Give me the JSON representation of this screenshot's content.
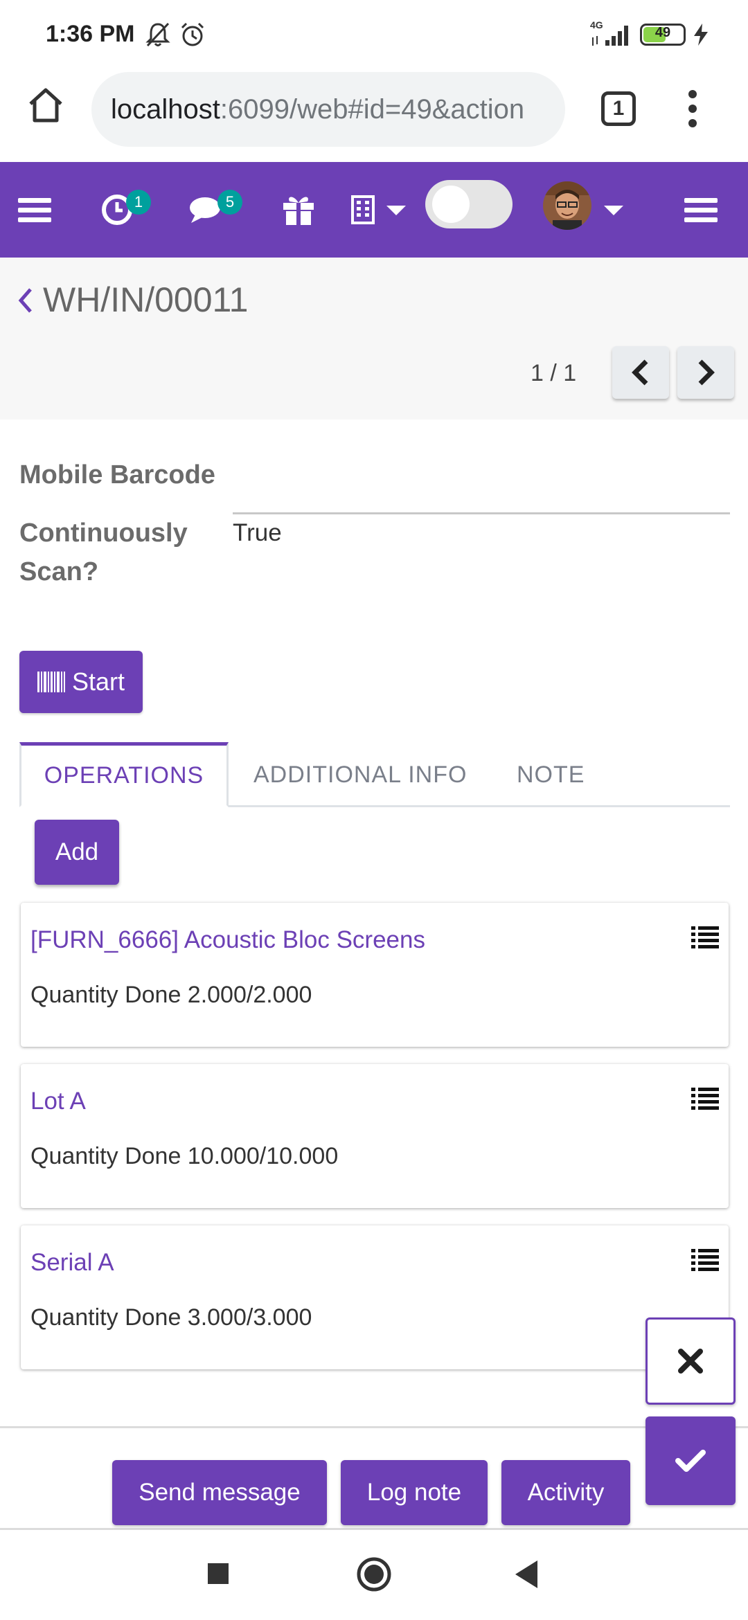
{
  "status_bar": {
    "time": "1:36 PM",
    "network": "4G",
    "battery": "49"
  },
  "browser": {
    "url_host": "localhost",
    "url_rest": ":6099/web#id=49&action",
    "tab_count": "1"
  },
  "navbar": {
    "activity_count": "1",
    "message_count": "5"
  },
  "control_panel": {
    "title": "WH/IN/00011",
    "pager": "1 / 1"
  },
  "form": {
    "mobile_barcode_label": "Mobile Barcode",
    "continuous_scan_label_1": "Continuously",
    "continuous_scan_label_2": "Scan?",
    "continuous_scan_value": "True",
    "start_label": "Start"
  },
  "tabs": [
    {
      "label": "OPERATIONS"
    },
    {
      "label": "ADDITIONAL INFO"
    },
    {
      "label": "NOTE"
    }
  ],
  "add_label": "Add",
  "operations": [
    {
      "title": "[FURN_6666] Acoustic Bloc Screens",
      "qty": "Quantity Done 2.000/2.000"
    },
    {
      "title": "Lot A",
      "qty": "Quantity Done 10.000/10.000"
    },
    {
      "title": "Serial A",
      "qty": "Quantity Done 3.000/3.000"
    }
  ],
  "chatter": {
    "send_message": "Send message",
    "log_note": "Log note",
    "activity": "Activity"
  },
  "colors": {
    "brand": "#6c40b5",
    "badge": "#00a09d"
  },
  "icons": [
    "home-icon",
    "tabs-icon",
    "more-vert-icon",
    "menu-icon",
    "clock-icon",
    "chat-icon",
    "gift-icon",
    "building-icon",
    "avatar",
    "chevron-left-icon",
    "chevron-right-icon",
    "barcode-icon",
    "list-icon",
    "close-icon",
    "check-icon"
  ]
}
